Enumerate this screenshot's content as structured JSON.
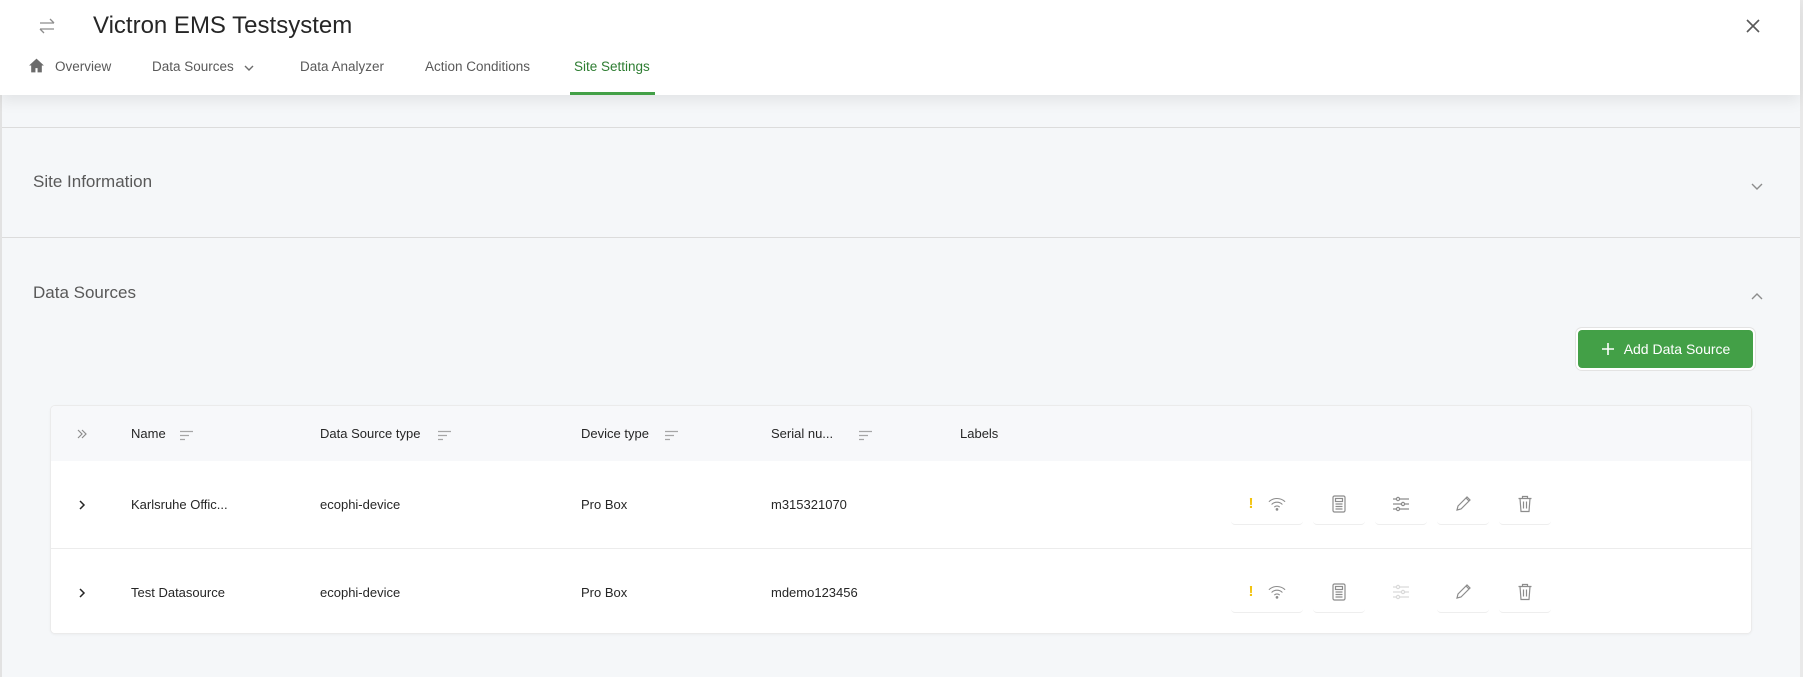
{
  "header": {
    "title": "Victron EMS Testsystem",
    "swap_icon": "swap-arrows-icon",
    "close_icon": "close-icon"
  },
  "tabs": [
    {
      "label": "Overview",
      "icon": "home-icon",
      "active": false
    },
    {
      "label": "Data Sources",
      "icon": "chevron-down-icon",
      "active": false
    },
    {
      "label": "Data Analyzer",
      "active": false
    },
    {
      "label": "Action Conditions",
      "active": false
    },
    {
      "label": "Site Settings",
      "active": true
    }
  ],
  "sections": {
    "site_information": {
      "title": "Site Information",
      "expanded": false
    },
    "data_sources": {
      "title": "Data Sources",
      "expanded": true
    }
  },
  "add_button": {
    "label": "Add Data Source",
    "icon": "plus-icon"
  },
  "table": {
    "columns": [
      "Name",
      "Data Source type",
      "Device type",
      "Serial nu...",
      "Labels"
    ],
    "rows": [
      {
        "name": "Karlsruhe Offic...",
        "type": "ecophi-device",
        "device": "Pro Box",
        "serial": "m315321070",
        "labels": "",
        "warning": "!",
        "settings_enabled": true
      },
      {
        "name": "Test Datasource",
        "type": "ecophi-device",
        "device": "Pro Box",
        "serial": "mdemo123456",
        "labels": "",
        "warning": "!",
        "settings_enabled": false
      }
    ]
  },
  "colors": {
    "accent": "#43a047",
    "active_tab": "#2e7d32",
    "warning": "#f2c30f"
  }
}
